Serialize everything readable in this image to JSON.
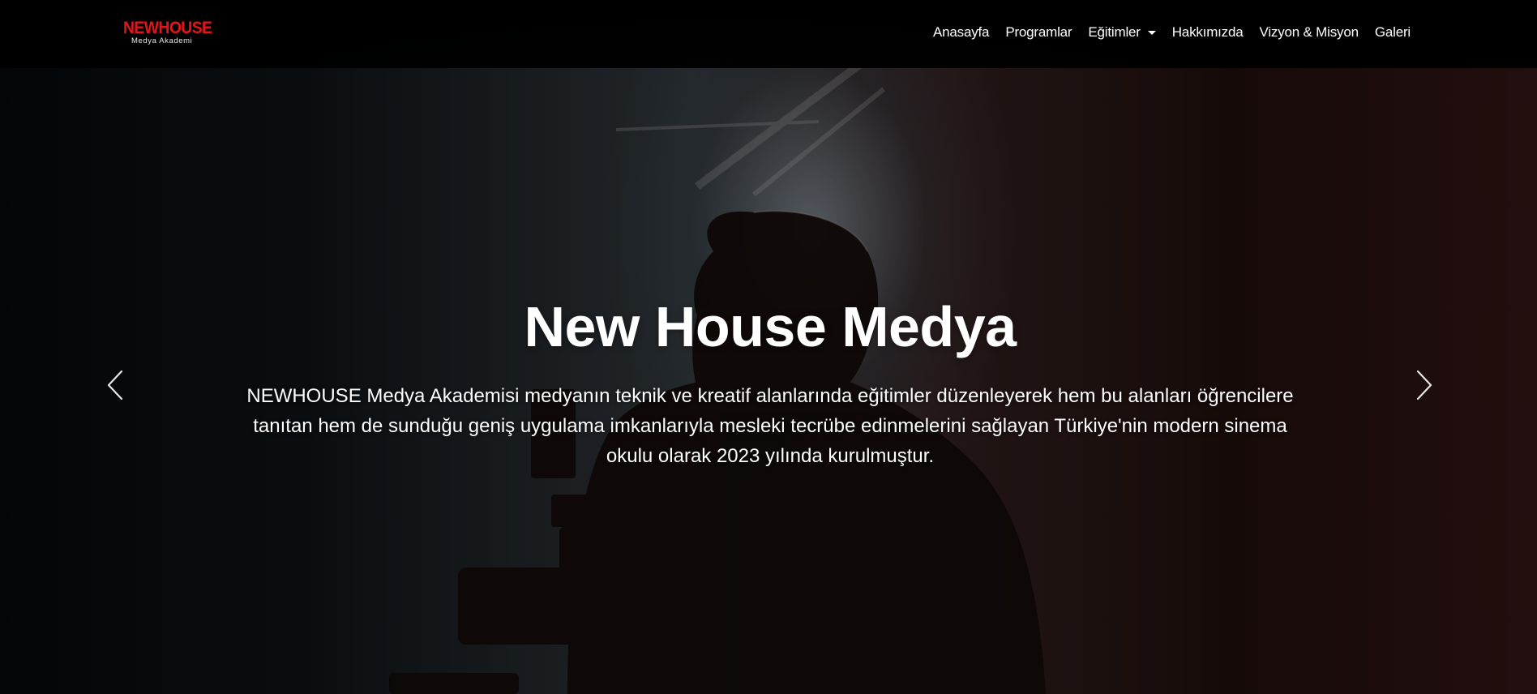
{
  "brand": {
    "name": "NEWHOUSE",
    "tagline": "Medya Akademi"
  },
  "nav": {
    "items": [
      {
        "label": "Anasayfa"
      },
      {
        "label": "Programlar"
      },
      {
        "label": "Eğitimler",
        "dropdown": true
      },
      {
        "label": "Hakkımızda"
      },
      {
        "label": "Vizyon & Misyon"
      },
      {
        "label": "Galeri"
      }
    ]
  },
  "hero": {
    "title": "New House Medya",
    "text": "NEWHOUSE Medya Akademisi medyanın teknik ve kreatif alanlarında eğitimler düzenleyerek hem bu alanları öğrencilere tanıtan hem de sunduğu geniş uygulama imkanlarıyla mesleki tecrübe edinmelerini sağlayan Türkiye'nin modern sinema okulu olarak 2023 yılında kurulmuştur."
  },
  "carousel": {
    "prev_icon": "chevron-left-icon",
    "next_icon": "chevron-right-icon"
  },
  "colors": {
    "brand_red": "#e4141b",
    "nav_bg": "#000000",
    "text": "#ffffff"
  }
}
